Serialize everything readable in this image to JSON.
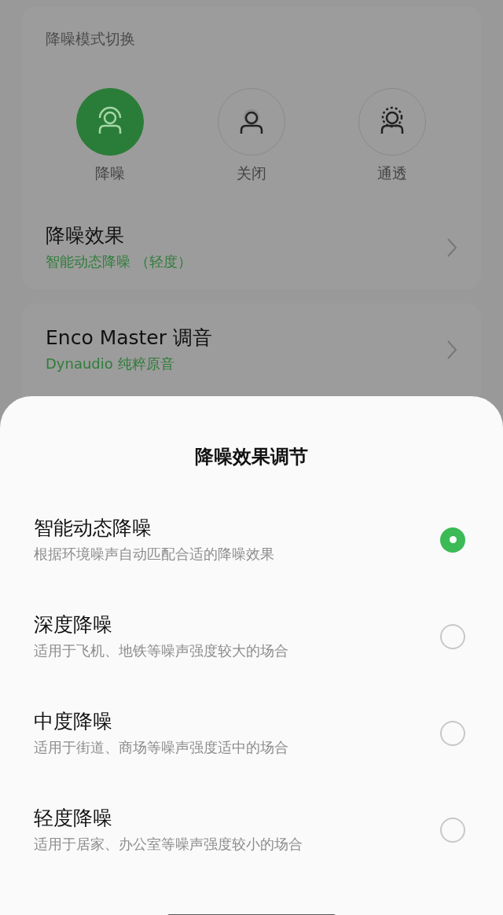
{
  "mode_card": {
    "title": "降噪模式切换",
    "modes": [
      {
        "label": "降噪",
        "kind": "anc",
        "selected": true
      },
      {
        "label": "关闭",
        "kind": "off",
        "selected": false
      },
      {
        "label": "通透",
        "kind": "transparency",
        "selected": false
      }
    ],
    "effect_row": {
      "title": "降噪效果",
      "value": "智能动态降噪 （轻度）"
    }
  },
  "tuning_card": {
    "title": "Enco Master 调音",
    "value": "Dynaudio 纯粹原音"
  },
  "sheet": {
    "title": "降噪效果调节",
    "options": [
      {
        "title": "智能动态降噪",
        "description": "根据环境噪声自动匹配合适的降噪效果",
        "selected": true
      },
      {
        "title": "深度降噪",
        "description": "适用于飞机、地铁等噪声强度较大的场合",
        "selected": false
      },
      {
        "title": "中度降噪",
        "description": "适用于街道、商场等噪声强度适中的场合",
        "selected": false
      },
      {
        "title": "轻度降噪",
        "description": "适用于居家、办公室等噪声强度较小的场合",
        "selected": false
      }
    ]
  }
}
